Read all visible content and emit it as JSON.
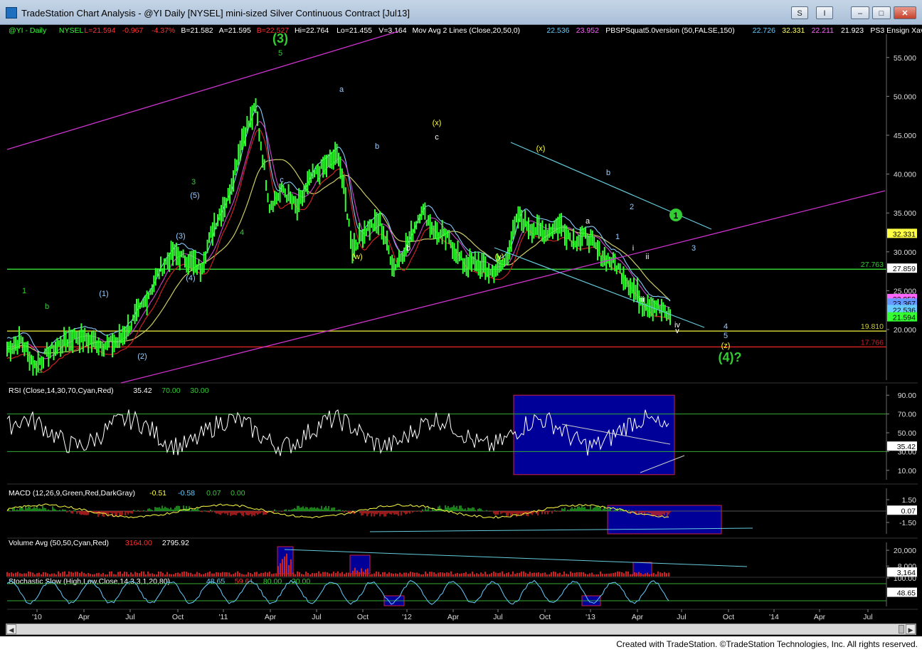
{
  "window": {
    "title": "TradeStation Chart Analysis - @YI Daily [NYSEL] mini-sized Silver Continuous Contract [Jul13]",
    "buttons": {
      "s": "S",
      "i": "I",
      "min": "–",
      "max": "□",
      "close": "✕"
    }
  },
  "footer": "Created with TradeStation. ©TradeStation Technologies, Inc. All rights reserved.",
  "colors": {
    "background": "#000000",
    "price_up": "#33ff33",
    "rsi_box": "#000099",
    "trend_magenta": "#cc33cc",
    "trend_cyan": "#66ccdd"
  },
  "chart_data": [
    {
      "type": "candlestick",
      "symbol_label": "@YI - Daily",
      "header": [
        {
          "text": "@YI - Daily",
          "color": "#33ff33"
        },
        {
          "text": "NYSEL",
          "color": "#33ff33"
        },
        {
          "text": "L=21.594",
          "color": "#ff3333"
        },
        {
          "text": "-0.967",
          "color": "#ff3333"
        },
        {
          "text": "-4.37%",
          "color": "#ff3333"
        },
        {
          "text": "B=21.582",
          "color": "#ffffff"
        },
        {
          "text": "A=21.595",
          "color": "#ffffff"
        },
        {
          "text": "B=22.527",
          "color": "#ff3333"
        },
        {
          "text": "Hi=22.764",
          "color": "#ffffff"
        },
        {
          "text": "Lo=21.455",
          "color": "#ffffff"
        },
        {
          "text": "V=3,164",
          "color": "#ffffff"
        },
        {
          "text": "Mov Avg 2 Lines (Close,20,50,0)",
          "color": "#ffffff"
        },
        {
          "text": "22.536",
          "color": "#66ccff"
        },
        {
          "text": "23.952",
          "color": "#ff66ff"
        },
        {
          "text": "PBSPSquat5.0version (50,FALSE,150)",
          "color": "#ffffff"
        },
        {
          "text": "22.726",
          "color": "#66ccff"
        },
        {
          "text": "32.331",
          "color": "#ffff66"
        },
        {
          "text": "22.211",
          "color": "#ff66ff"
        },
        {
          "text": "21.923",
          "color": "#ffffff"
        },
        {
          "text": "PS3 Ensign Xave ...",
          "color": "#ffffff"
        }
      ],
      "x_ticks": [
        "'10",
        "Apr",
        "Jul",
        "Oct",
        "'11",
        "Apr",
        "Jul",
        "Oct",
        "'12",
        "Apr",
        "Jul",
        "Oct",
        "'13",
        "Apr",
        "Jul",
        "Oct",
        "'14",
        "Apr",
        "Jul"
      ],
      "y_ticks": [
        55.0,
        50.0,
        45.0,
        40.0,
        35.0,
        30.0,
        25.0,
        20.0
      ],
      "y_tick_labels": [
        "55.000",
        "50.000",
        "45.000",
        "40.000",
        "35.000",
        "30.000",
        "25.000",
        "20.000"
      ],
      "ylim": [
        13.5,
        58
      ],
      "close_series": [
        [
          "'10",
          17.5
        ],
        [
          "Jan",
          18.6
        ],
        [
          "Feb",
          15.3
        ],
        [
          "Mar",
          17.0
        ],
        [
          "Apr",
          18.3
        ],
        [
          "May",
          19.2
        ],
        [
          "Jun",
          18.6
        ],
        [
          "Jul",
          18.0
        ],
        [
          "Aug",
          18.4
        ],
        [
          "Sep",
          20.8
        ],
        [
          "Oct",
          23.6
        ],
        [
          "Nov",
          27.5
        ],
        [
          "Dec",
          29.8
        ],
        [
          "'11",
          29.0
        ],
        [
          "Jan",
          27.8
        ],
        [
          "Feb",
          33.5
        ],
        [
          "Mar",
          37.0
        ],
        [
          "Apr",
          44.5
        ],
        [
          "Apr",
          48.5
        ],
        [
          "May",
          36.0
        ],
        [
          "May",
          38.0
        ],
        [
          "Jun",
          35.5
        ],
        [
          "Jul",
          39.5
        ],
        [
          "Aug",
          41.0
        ],
        [
          "Sep",
          42.5
        ],
        [
          "Sep",
          30.5
        ],
        [
          "Oct",
          33.0
        ],
        [
          "Nov",
          33.8
        ],
        [
          "Dec",
          28.0
        ],
        [
          "'12",
          31.0
        ],
        [
          "Feb",
          35.5
        ],
        [
          "Mar",
          32.5
        ],
        [
          "Apr",
          31.5
        ],
        [
          "May",
          28.5
        ],
        [
          "Jun",
          28.5
        ],
        [
          "Jul",
          27.3
        ],
        [
          "Aug",
          28.5
        ],
        [
          "Sep",
          34.5
        ],
        [
          "Oct",
          33.0
        ],
        [
          "Nov",
          32.5
        ],
        [
          "Dec",
          33.5
        ],
        [
          "'13",
          31.5
        ],
        [
          "Jan",
          32.0
        ],
        [
          "Feb",
          29.5
        ],
        [
          "Mar",
          28.5
        ],
        [
          "Apr",
          26.0
        ],
        [
          "Apr",
          23.5
        ],
        [
          "May",
          23.0
        ],
        [
          "Jun",
          21.6
        ]
      ],
      "horizontal_lines": [
        {
          "value": 27.763,
          "label": "27.763",
          "color": "#33cc33"
        },
        {
          "value": 19.81,
          "label": "19.810",
          "color": "#cccc33"
        },
        {
          "value": 17.766,
          "label": "17.766",
          "color": "#cc2222"
        }
      ],
      "value_tags": [
        {
          "value": 32.331,
          "label": "32.331",
          "color": "#ffff44"
        },
        {
          "value": 27.859,
          "label": "27.859",
          "color": "#ffffff"
        },
        {
          "value": 23.952,
          "label": "23.952",
          "color": "#ff66ff"
        },
        {
          "value": 23.367,
          "label": "23.367",
          "color": "#6699ff"
        },
        {
          "value": 22.536,
          "label": "22.536",
          "color": "#66ccff"
        },
        {
          "value": 21.594,
          "label": "21.594",
          "color": "#33ff33"
        }
      ],
      "wave_labels": [
        {
          "text": "(3)",
          "color": "#33cc33",
          "big": true
        },
        {
          "text": "5",
          "color": "#33cc33"
        },
        {
          "text": "3",
          "color": "#33cc33"
        },
        {
          "text": "1",
          "color": "#33cc33"
        },
        {
          "text": "(5)",
          "color": "#99ccff"
        },
        {
          "text": "(3)",
          "color": "#99ccff"
        },
        {
          "text": "(4)",
          "color": "#99ccff"
        },
        {
          "text": "(1)",
          "color": "#99ccff"
        },
        {
          "text": "(2)",
          "color": "#99ccff"
        },
        {
          "text": "4",
          "color": "#33cc33"
        },
        {
          "text": "a",
          "color": "#33cc33"
        },
        {
          "text": "b",
          "color": "#33cc33"
        },
        {
          "text": "c",
          "color": "#33cc33"
        },
        {
          "text": "(w)",
          "color": "#ffff33"
        },
        {
          "text": "(x)",
          "color": "#ffff33"
        },
        {
          "text": "(y)",
          "color": "#ffff33"
        },
        {
          "text": "(x)",
          "color": "#ffff33"
        },
        {
          "text": "(z)",
          "color": "#ffff33"
        },
        {
          "text": "(4)?",
          "color": "#33cc33",
          "big": true
        },
        {
          "text": "a",
          "color": "#ffffff"
        },
        {
          "text": "b",
          "color": "#99ccff"
        },
        {
          "text": "1",
          "color": "#99ccff"
        },
        {
          "text": "2",
          "color": "#99ccff"
        },
        {
          "text": "i",
          "color": "#ffffff"
        },
        {
          "text": "ii",
          "color": "#ffffff"
        },
        {
          "text": "iii",
          "color": "#ffffff"
        },
        {
          "text": "iv",
          "color": "#ffffff"
        },
        {
          "text": "v",
          "color": "#ffffff"
        },
        {
          "text": "3",
          "color": "#99ccff"
        },
        {
          "text": "4",
          "color": "#99ccff"
        },
        {
          "text": "5",
          "color": "#99ccff"
        },
        {
          "text": "c",
          "color": "#99ccff"
        },
        {
          "text": "a",
          "color": "#99ccff"
        },
        {
          "text": "b",
          "color": "#99ccff"
        },
        {
          "text": "c",
          "color": "#ffffff"
        },
        {
          "text": "b",
          "color": "#ffffff"
        }
      ]
    },
    {
      "type": "line",
      "title": "RSI (Close,14,30,70,Cyan,Red)",
      "values_text": [
        {
          "text": "35.42",
          "color": "#ffffff"
        },
        {
          "text": "70.00",
          "color": "#33cc33"
        },
        {
          "text": "30.00",
          "color": "#33cc33"
        }
      ],
      "y_ticks": [
        90,
        70,
        50,
        30,
        10
      ],
      "y_tick_labels": [
        "90.00",
        "70.00",
        "50.00",
        "30.00",
        "10.00"
      ],
      "ylim": [
        0,
        100
      ],
      "levels": [
        70,
        30
      ],
      "last": {
        "value": 35.42,
        "label": "35.42"
      }
    },
    {
      "type": "histogram",
      "title": "MACD (12,26,9,Green,Red,DarkGray)",
      "values_text": [
        {
          "text": "-0.51",
          "color": "#ffff44"
        },
        {
          "text": "-0.58",
          "color": "#66ccff"
        },
        {
          "text": "0.07",
          "color": "#33cc33"
        },
        {
          "text": "0.00",
          "color": "#33cc33"
        }
      ],
      "y_ticks": [
        1.5,
        -1.5
      ],
      "y_tick_labels": [
        "1.50",
        "-1.50"
      ],
      "ylim": [
        -3,
        3
      ],
      "last": {
        "value": 0.07,
        "label": "0.07"
      }
    },
    {
      "type": "bar",
      "title": "Volume Avg (50,50,Cyan,Red)",
      "values_text": [
        {
          "text": "3164.00",
          "color": "#ff3333"
        },
        {
          "text": "2795.92",
          "color": "#ffffff"
        }
      ],
      "y_ticks": [
        20000,
        8000
      ],
      "y_tick_labels": [
        "20,000",
        "8,000"
      ],
      "ylim": [
        0,
        26000
      ],
      "last": {
        "value": 3164,
        "label": "3,164"
      }
    },
    {
      "type": "line",
      "title": "Stochastic Slow (High,Low,Close,14,3,3,1,20,80)",
      "values_text": [
        {
          "text": "48.65",
          "color": "#66ccff"
        },
        {
          "text": "59.61",
          "color": "#ff3333"
        },
        {
          "text": "80.00",
          "color": "#33cc33"
        },
        {
          "text": "20.00",
          "color": "#33cc33"
        }
      ],
      "y_ticks": [
        100
      ],
      "y_tick_labels": [
        "100.00"
      ],
      "ylim": [
        0,
        100
      ],
      "levels": [
        80,
        20
      ],
      "last": {
        "value": 48.65,
        "label": "48.65"
      }
    }
  ]
}
